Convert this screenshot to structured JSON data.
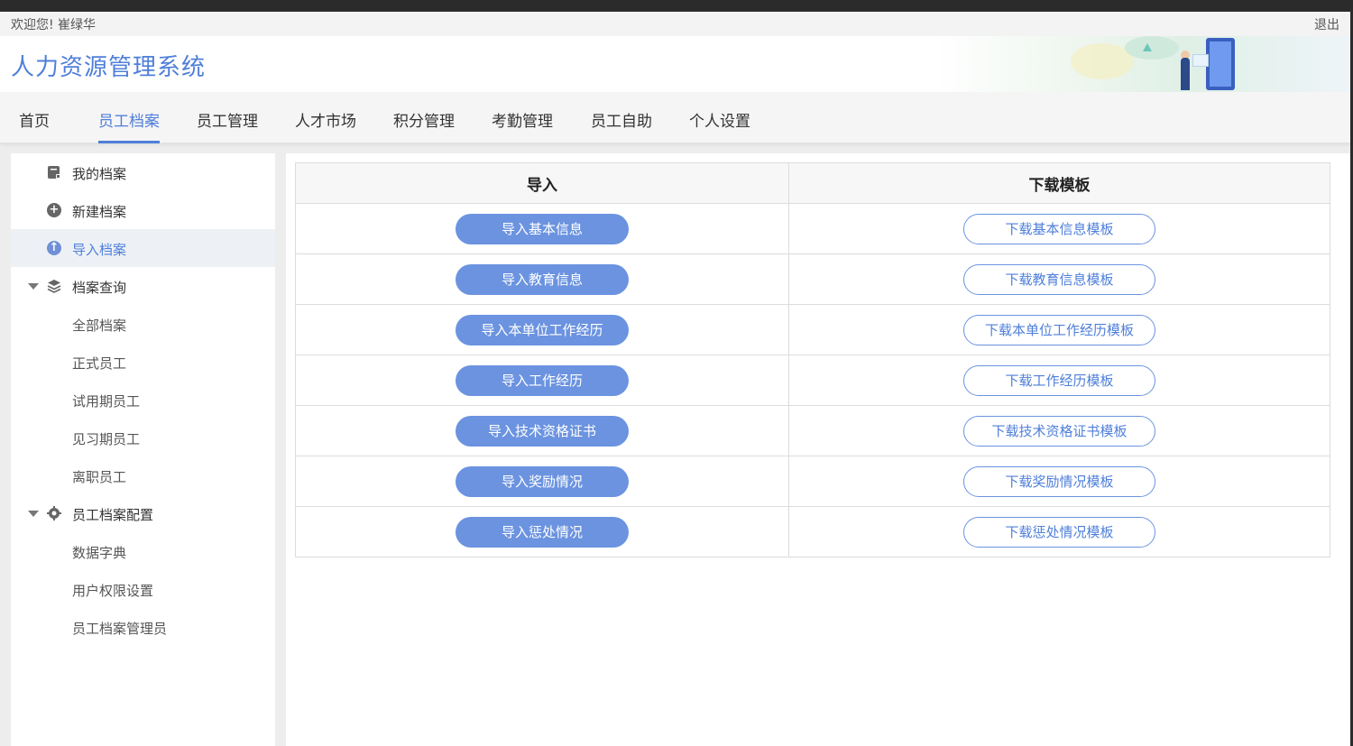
{
  "topbar": {
    "welcome": "欢迎您! 崔绿华",
    "logout": "退出"
  },
  "header": {
    "title": "人力资源管理系统"
  },
  "nav": {
    "items": [
      "首页",
      "员工档案",
      "员工管理",
      "人才市场",
      "积分管理",
      "考勤管理",
      "员工自助",
      "个人设置"
    ],
    "active": "员工档案"
  },
  "sidebar": {
    "items": [
      {
        "label": "我的档案",
        "icon": "file-icon"
      },
      {
        "label": "新建档案",
        "icon": "plus-circle-icon"
      },
      {
        "label": "导入档案",
        "icon": "upload-circle-icon",
        "active": true
      },
      {
        "label": "档案查询",
        "icon": "layers-icon",
        "expanded": true
      },
      {
        "label": "全部档案"
      },
      {
        "label": "正式员工"
      },
      {
        "label": "试用期员工"
      },
      {
        "label": "见习期员工"
      },
      {
        "label": "离职员工"
      },
      {
        "label": "员工档案配置",
        "icon": "gear-icon",
        "expanded": true
      },
      {
        "label": "数据字典"
      },
      {
        "label": "用户权限设置"
      },
      {
        "label": "员工档案管理员"
      }
    ]
  },
  "table": {
    "headers": [
      "导入",
      "下载模板"
    ],
    "rows": [
      {
        "import": "导入基本信息",
        "download": "下载基本信息模板"
      },
      {
        "import": "导入教育信息",
        "download": "下载教育信息模板"
      },
      {
        "import": "导入本单位工作经历",
        "download": "下载本单位工作经历模板"
      },
      {
        "import": "导入工作经历",
        "download": "下载工作经历模板"
      },
      {
        "import": "导入技术资格证书",
        "download": "下载技术资格证书模板"
      },
      {
        "import": "导入奖励情况",
        "download": "下载奖励情况模板"
      },
      {
        "import": "导入惩处情况",
        "download": "下载惩处情况模板"
      }
    ]
  },
  "colors": {
    "accent": "#4f7fd9",
    "button": "#6b93e0",
    "active_bg": "#edf1f6"
  }
}
